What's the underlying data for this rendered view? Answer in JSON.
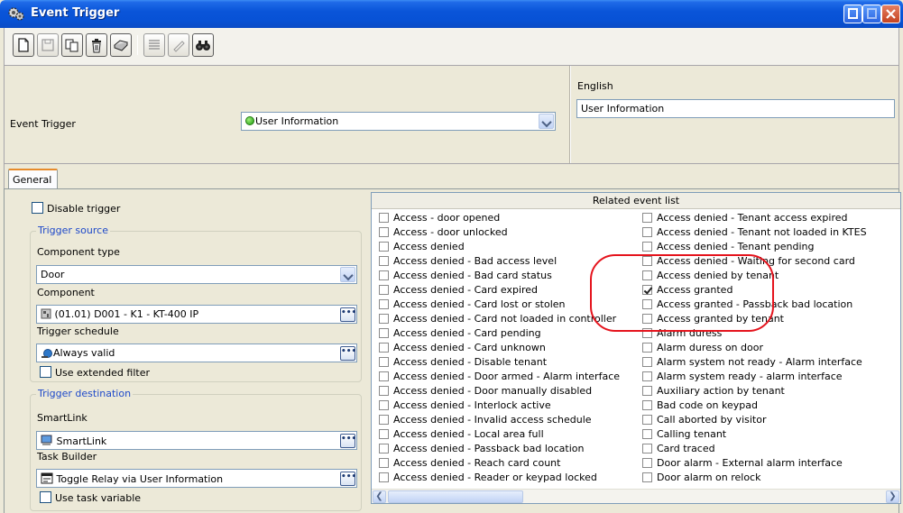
{
  "window": {
    "title": "Event Trigger"
  },
  "header": {
    "event_trigger_label": "Event Trigger",
    "event_trigger_value": "User Information",
    "language_label": "English",
    "language_value": "User Information"
  },
  "tabs": [
    {
      "label": "General"
    }
  ],
  "general": {
    "disable_trigger_label": "Disable trigger",
    "disable_trigger_checked": false,
    "trigger_source": {
      "title": "Trigger source",
      "component_type_label": "Component type",
      "component_type_value": "Door",
      "component_label": "Component",
      "component_value": "(01.01) D001 - K1 - KT-400 IP",
      "schedule_label": "Trigger schedule",
      "schedule_value": "Always valid",
      "extended_filter_label": "Use extended filter"
    },
    "trigger_destination": {
      "title": "Trigger destination",
      "smartlink_label": "SmartLink",
      "smartlink_value": "SmartLink",
      "task_builder_label": "Task Builder",
      "task_builder_value": "Toggle Relay via User Information",
      "task_variable_label": "Use task variable"
    }
  },
  "related": {
    "title": "Related event list",
    "left": [
      {
        "label": "Access - door opened",
        "checked": false
      },
      {
        "label": "Access - door unlocked",
        "checked": false
      },
      {
        "label": "Access denied",
        "checked": false
      },
      {
        "label": "Access denied - Bad access level",
        "checked": false
      },
      {
        "label": "Access denied - Bad card status",
        "checked": false
      },
      {
        "label": "Access denied - Card expired",
        "checked": false
      },
      {
        "label": "Access denied - Card lost or stolen",
        "checked": false
      },
      {
        "label": "Access denied - Card not loaded in controller",
        "checked": false
      },
      {
        "label": "Access denied - Card pending",
        "checked": false
      },
      {
        "label": "Access denied - Card unknown",
        "checked": false
      },
      {
        "label": "Access denied - Disable tenant",
        "checked": false
      },
      {
        "label": "Access denied - Door armed - Alarm interface",
        "checked": false
      },
      {
        "label": "Access denied - Door manually disabled",
        "checked": false
      },
      {
        "label": "Access denied - Interlock active",
        "checked": false
      },
      {
        "label": "Access denied - Invalid access schedule",
        "checked": false
      },
      {
        "label": "Access denied - Local area full",
        "checked": false
      },
      {
        "label": "Access denied - Passback bad location",
        "checked": false
      },
      {
        "label": "Access denied - Reach card count",
        "checked": false
      },
      {
        "label": "Access denied - Reader or keypad locked",
        "checked": false
      }
    ],
    "right": [
      {
        "label": "Access denied - Tenant access expired",
        "checked": false
      },
      {
        "label": "Access denied - Tenant not loaded in KTES",
        "checked": false
      },
      {
        "label": "Access denied - Tenant pending",
        "checked": false
      },
      {
        "label": "Access denied - Waiting for second card",
        "checked": false
      },
      {
        "label": "Access denied by tenant",
        "checked": false
      },
      {
        "label": "Access granted",
        "checked": true
      },
      {
        "label": "Access granted - Passback bad location",
        "checked": false
      },
      {
        "label": "Access granted by tenant",
        "checked": false
      },
      {
        "label": "Alarm duress",
        "checked": false
      },
      {
        "label": "Alarm duress on door",
        "checked": false
      },
      {
        "label": "Alarm system not ready - Alarm interface",
        "checked": false
      },
      {
        "label": "Alarm system ready - alarm interface",
        "checked": false
      },
      {
        "label": "Auxiliary action by tenant",
        "checked": false
      },
      {
        "label": "Bad code on keypad",
        "checked": false
      },
      {
        "label": "Call aborted by visitor",
        "checked": false
      },
      {
        "label": "Calling tenant",
        "checked": false
      },
      {
        "label": "Card traced",
        "checked": false
      },
      {
        "label": "Door alarm - External alarm interface",
        "checked": false
      },
      {
        "label": "Door alarm on relock",
        "checked": false
      }
    ]
  },
  "toolbar": {
    "buttons": [
      {
        "icon": "new-icon",
        "enabled": true
      },
      {
        "icon": "save-icon",
        "enabled": false
      },
      {
        "icon": "copy-icon",
        "enabled": true
      },
      {
        "icon": "delete-icon",
        "enabled": true
      },
      {
        "icon": "print-icon",
        "enabled": true
      },
      {
        "icon": "list-icon",
        "enabled": false
      },
      {
        "icon": "edit-icon",
        "enabled": false
      },
      {
        "icon": "find-icon",
        "enabled": true
      }
    ]
  },
  "colors": {
    "titlebar": "#0a55d9",
    "group_title": "#1e49c9",
    "highlight_oval": "#e5141d"
  }
}
